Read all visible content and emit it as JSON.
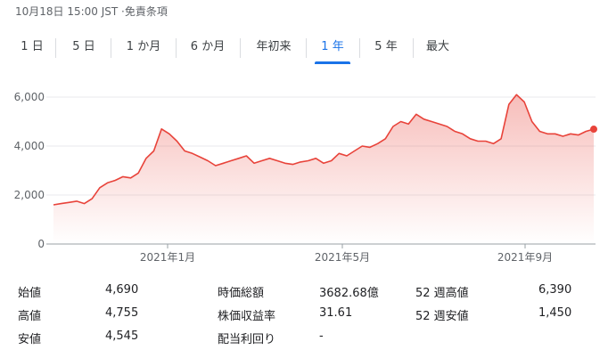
{
  "header": {
    "timestamp": "10月18日 15:00 JST ·免責条項"
  },
  "tabs": [
    {
      "label": "1 日",
      "active": false
    },
    {
      "label": "5 日",
      "active": false
    },
    {
      "label": "1 か月",
      "active": false
    },
    {
      "label": "6 か月",
      "active": false
    },
    {
      "label": "年初来",
      "active": false
    },
    {
      "label": "1 年",
      "active": true
    },
    {
      "label": "5 年",
      "active": false
    },
    {
      "label": "最大",
      "active": false
    }
  ],
  "colors": {
    "accent": "#1a73e8",
    "line": "#e8433a",
    "grid": "#e8eaed"
  },
  "chart_data": {
    "type": "area",
    "title": "",
    "xlabel": "",
    "ylabel": "",
    "ylim": [
      0,
      6400
    ],
    "y_ticks": [
      "0",
      "2,000",
      "4,000",
      "6,000"
    ],
    "y_tick_values": [
      0,
      2000,
      4000,
      6000
    ],
    "x_ticks": [
      "2021年1月",
      "2021年5月",
      "2021年9月"
    ],
    "x_tick_positions": [
      0.26,
      0.63,
      1.0
    ],
    "grid": true,
    "legend": "none",
    "series": [
      {
        "values_x": [
          0.0,
          0.02,
          0.04,
          0.06,
          0.08,
          0.1,
          0.12,
          0.14,
          0.16,
          0.18,
          0.2,
          0.22,
          0.24,
          0.26,
          0.28,
          0.3,
          0.32,
          0.34,
          0.36,
          0.38,
          0.4,
          0.42,
          0.44,
          0.46,
          0.48,
          0.5,
          0.52,
          0.54,
          0.56,
          0.58,
          0.6,
          0.62,
          0.64,
          0.66,
          0.68,
          0.7,
          0.72,
          0.74,
          0.76,
          0.78,
          0.8,
          0.82,
          0.84,
          0.86,
          0.88,
          0.9,
          0.92,
          0.94,
          0.96,
          0.98,
          1.0,
          1.02,
          1.04,
          1.06,
          1.08,
          1.1,
          1.12,
          1.14,
          1.16,
          1.18,
          1.2,
          1.22,
          1.24,
          1.26,
          1.28,
          1.3,
          1.32,
          1.34,
          1.36,
          1.38,
          1.4
        ],
        "values": [
          1600,
          1650,
          1700,
          1750,
          1650,
          1850,
          2300,
          2500,
          2600,
          2750,
          2700,
          2900,
          3500,
          3800,
          4700,
          4500,
          4200,
          3800,
          3700,
          3550,
          3400,
          3200,
          3300,
          3400,
          3500,
          3600,
          3300,
          3400,
          3500,
          3400,
          3300,
          3250,
          3350,
          3400,
          3500,
          3300,
          3400,
          3700,
          3600,
          3800,
          4000,
          3950,
          4100,
          4300,
          4800,
          5000,
          4900,
          5300,
          5100,
          5000,
          4900,
          4800,
          4600,
          4500,
          4300,
          4200,
          4200,
          4100,
          4300,
          5700,
          6100,
          5800,
          5000,
          4600,
          4500,
          4500,
          4400,
          4500,
          4450,
          4600,
          4690
        ]
      }
    ]
  },
  "stats": {
    "col1": [
      {
        "label": "始値",
        "value": "4,690"
      },
      {
        "label": "高値",
        "value": "4,755"
      },
      {
        "label": "安値",
        "value": "4,545"
      }
    ],
    "col2": [
      {
        "label": "時価総額",
        "value": "3682.68億"
      },
      {
        "label": "株価収益率",
        "value": "31.61"
      },
      {
        "label": "配当利回り",
        "value": "-"
      }
    ],
    "col3": [
      {
        "label": "52 週高値",
        "value": "6,390"
      },
      {
        "label": "52 週安値",
        "value": "1,450"
      }
    ]
  }
}
